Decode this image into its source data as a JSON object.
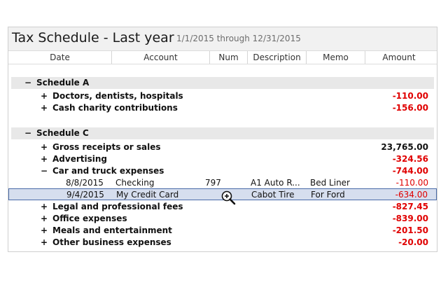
{
  "report": {
    "title": "Tax Schedule - Last year",
    "date_range": "1/1/2015 through 12/31/2015"
  },
  "columns": [
    "Date",
    "Account",
    "Num",
    "Description",
    "Memo",
    "Amount"
  ],
  "groups": [
    {
      "toggle": "−",
      "label": "Schedule A",
      "items": [
        {
          "toggle": "+",
          "label": "Doctors, dentists, hospitals",
          "amount": "-110.00"
        },
        {
          "toggle": "+",
          "label": "Cash charity contributions",
          "amount": "-156.00"
        }
      ]
    },
    {
      "toggle": "−",
      "label": "Schedule C",
      "items": [
        {
          "toggle": "+",
          "label": "Gross receipts or sales",
          "amount": "23,765.00"
        },
        {
          "toggle": "+",
          "label": "Advertising",
          "amount": "-324.56"
        },
        {
          "toggle": "−",
          "label": "Car and truck expenses",
          "amount": "-744.00"
        },
        {
          "toggle": "+",
          "label": "Legal and professional fees",
          "amount": "-827.45"
        },
        {
          "toggle": "+",
          "label": "Office expenses",
          "amount": "-839.00"
        },
        {
          "toggle": "+",
          "label": "Meals and entertainment",
          "amount": "-201.50"
        },
        {
          "toggle": "+",
          "label": "Other business expenses",
          "amount": "-20.00"
        }
      ]
    }
  ],
  "transactions": [
    {
      "date": "8/8/2015",
      "account": "Checking",
      "num": "797",
      "description": "A1 Auto R...",
      "memo": "Bed Liner",
      "amount": "-110.00"
    },
    {
      "date": "9/4/2015",
      "account": "My Credit Card",
      "num": "",
      "description": "Cabot Tire",
      "memo": "For Ford",
      "amount": "-634.00"
    }
  ],
  "colors": {
    "negative": "#e00000",
    "selection": "#d6deee",
    "group_bg": "#e8e8e8"
  },
  "cursor_icon": "zoom-in-magnifier-icon"
}
